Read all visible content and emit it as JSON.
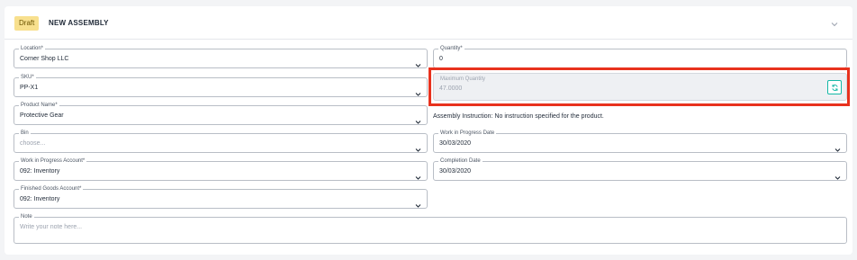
{
  "header": {
    "status_badge": "Draft",
    "title": "NEW ASSEMBLY",
    "collapse_icon": "chevron-down-icon"
  },
  "fields": {
    "location": {
      "label": "Location*",
      "value": "Corner Shop LLC"
    },
    "sku": {
      "label": "SKU*",
      "value": "PP-X1"
    },
    "product_name": {
      "label": "Product Name*",
      "value": "Protective Gear"
    },
    "bin": {
      "label": "Bin",
      "placeholder": "choose..."
    },
    "wip_account": {
      "label": "Work in Progress Account*",
      "value": "092: Inventory"
    },
    "finished_goods_account": {
      "label": "Finished Goods Account*",
      "value": "092: Inventory"
    },
    "quantity": {
      "label": "Quantity*",
      "value": "0"
    },
    "max_quantity": {
      "label": "Maximum Quantity",
      "value": "47.0000",
      "refresh_icon": "refresh-icon"
    },
    "wip_date": {
      "label": "Work in Progress Date",
      "value": "30/03/2020"
    },
    "completion_date": {
      "label": "Completion Date",
      "value": "30/03/2020"
    },
    "note": {
      "label": "Note",
      "placeholder": "Write your note here..."
    }
  },
  "assembly_instruction": "Assembly Instruction: No instruction specified for the product.",
  "colors": {
    "badge_bg": "#f8e08e",
    "accent": "#14b8a6",
    "highlight": "#e8321e"
  }
}
